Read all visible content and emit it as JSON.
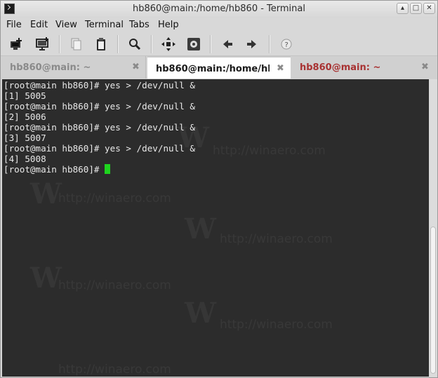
{
  "window": {
    "title": "hb860@main:/home/hb860 - Terminal",
    "controls": [
      "▴",
      "□",
      "✕"
    ]
  },
  "menu": [
    "File",
    "Edit",
    "View",
    "Terminal",
    "Tabs",
    "Help"
  ],
  "toolbar": {
    "icons": [
      "new-tab-icon",
      "new-window-icon",
      "copy-icon",
      "paste-icon",
      "search-icon",
      "fullscreen-icon",
      "preferences-icon",
      "previous-tab-icon",
      "next-tab-icon",
      "about-icon"
    ]
  },
  "tabs": [
    {
      "label": "hb860@main: ~",
      "close": "✖",
      "active": false,
      "color": "#8a8a8a"
    },
    {
      "label": "hb860@main:/home/hb...",
      "close": "✖",
      "active": true,
      "color": "#1a1a1a"
    },
    {
      "label": "hb860@main: ~",
      "close": "✖",
      "active": false,
      "color": "#a83232"
    }
  ],
  "terminal": {
    "lines": [
      "[root@main hb860]# yes > /dev/null &",
      "[1] 5005",
      "[root@main hb860]# yes > /dev/null &",
      "[2] 5006",
      "[root@main hb860]# yes > /dev/null &",
      "[3] 5007",
      "[root@main hb860]# yes > /dev/null &",
      "[4] 5008"
    ],
    "prompt": "[root@main hb860]# ",
    "cursor_color": "#1ed41e",
    "watermark": "http://winaero.com",
    "watermark_logo": "W"
  }
}
